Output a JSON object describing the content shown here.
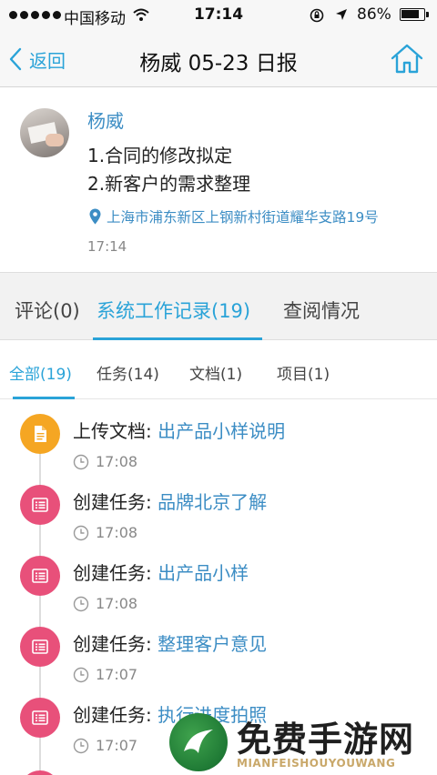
{
  "status_bar": {
    "carrier": "中国移动",
    "time": "17:14",
    "battery_percent": "86%",
    "battery_level": 0.86
  },
  "nav": {
    "back_label": "返回",
    "title": "杨威 05-23 日报",
    "home_icon": "home-icon"
  },
  "report": {
    "author": "杨威",
    "content": [
      "1.合同的修改拟定",
      "2.新客户的需求整理"
    ],
    "location": "上海市浦东新区上钢新村街道耀华支路19号",
    "time": "17:14"
  },
  "main_tabs": [
    {
      "label": "评论(0)",
      "active": false
    },
    {
      "label": "系统工作记录(19)",
      "active": true
    },
    {
      "label": "查阅情况",
      "active": false
    }
  ],
  "sub_tabs": [
    {
      "label": "全部(19)",
      "active": true
    },
    {
      "label": "任务(14)",
      "active": false
    },
    {
      "label": "文档(1)",
      "active": false
    },
    {
      "label": "项目(1)",
      "active": false
    }
  ],
  "timeline": [
    {
      "type": "document",
      "icon": "document-icon",
      "color": "#f5a623",
      "action": "上传文档:",
      "target": "出产品小样说明",
      "time": "17:08"
    },
    {
      "type": "task",
      "icon": "task-list-icon",
      "color": "#e8507a",
      "action": "创建任务:",
      "target": "品牌北京了解",
      "time": "17:08"
    },
    {
      "type": "task",
      "icon": "task-list-icon",
      "color": "#e8507a",
      "action": "创建任务:",
      "target": "出产品小样",
      "time": "17:08"
    },
    {
      "type": "task",
      "icon": "task-list-icon",
      "color": "#e8507a",
      "action": "创建任务:",
      "target": "整理客户意见",
      "time": "17:07"
    },
    {
      "type": "task",
      "icon": "task-list-icon",
      "color": "#e8507a",
      "action": "创建任务:",
      "target": "执行进度拍照",
      "time": "17:07"
    }
  ],
  "watermark": {
    "title": "免费手游网",
    "subtitle": "MIANFEISHOUYOUWANG"
  },
  "colors": {
    "accent": "#2aa3d8",
    "link": "#3c8dc4",
    "document": "#f5a623",
    "task": "#e8507a"
  }
}
